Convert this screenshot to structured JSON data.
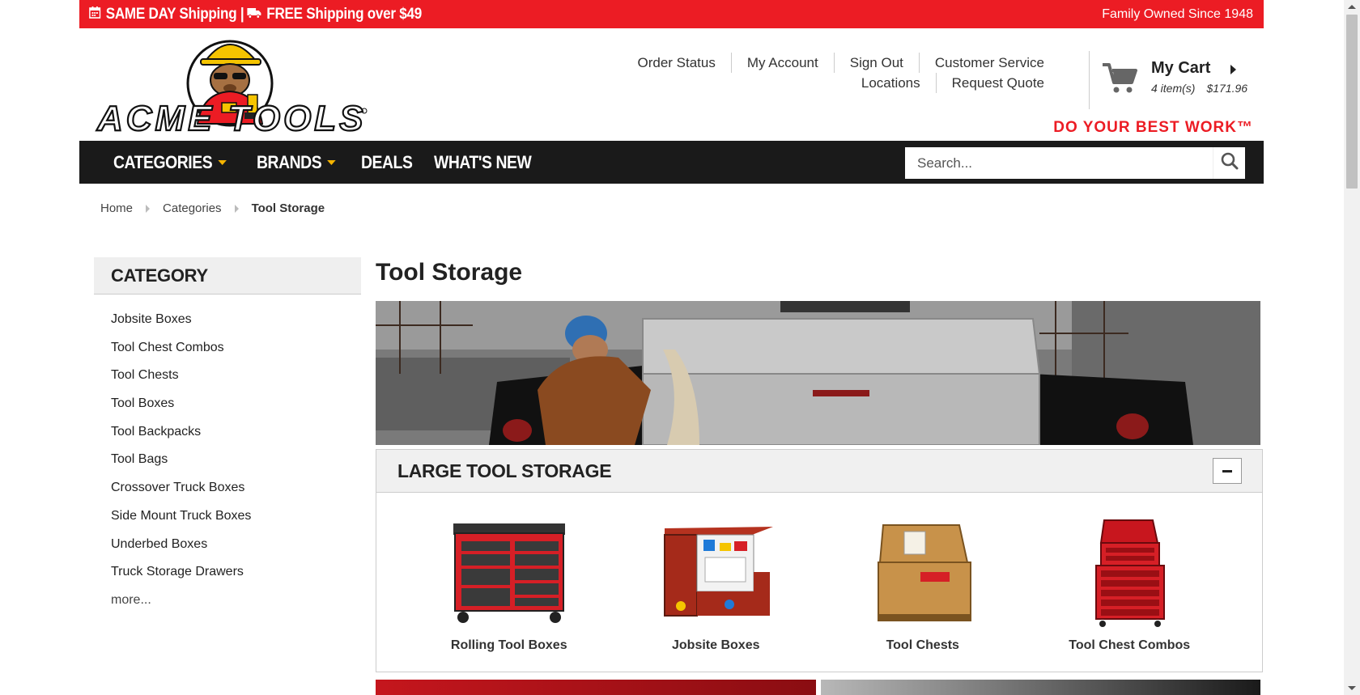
{
  "promo": {
    "left_text": "SAME DAY Shipping | ",
    "left_text2": "FREE Shipping over $49",
    "right_text": "Family Owned Since 1948",
    "bg_color": "#ec1c24"
  },
  "brand": {
    "logo_text": "ACME TOOLS",
    "tagline": "DO YOUR BEST WORK™"
  },
  "toplinks": {
    "row1": [
      "Order Status",
      "My Account",
      "Sign Out",
      "Customer Service"
    ],
    "row2": [
      "Locations",
      "Request Quote"
    ]
  },
  "cart": {
    "title": "My Cart",
    "items": "4 item(s)",
    "total": "$171.96"
  },
  "nav": {
    "items": [
      "CATEGORIES",
      "BRANDS",
      "DEALS",
      "WHAT'S NEW"
    ],
    "search_placeholder": "Search..."
  },
  "breadcrumb": [
    "Home",
    "Categories",
    "Tool Storage"
  ],
  "sidebar": {
    "heading": "CATEGORY",
    "items": [
      "Jobsite Boxes",
      "Tool Chest Combos",
      "Tool Chests",
      "Tool Boxes",
      "Tool Backpacks",
      "Tool Bags",
      "Crossover Truck Boxes",
      "Side Mount Truck Boxes",
      "Underbed Boxes",
      "Truck Storage Drawers",
      "more..."
    ]
  },
  "main": {
    "title": "Tool Storage",
    "section_title": "LARGE TOOL STORAGE",
    "products": [
      "Rolling Tool Boxes",
      "Jobsite Boxes",
      "Tool Chests",
      "Tool Chest Combos"
    ]
  }
}
